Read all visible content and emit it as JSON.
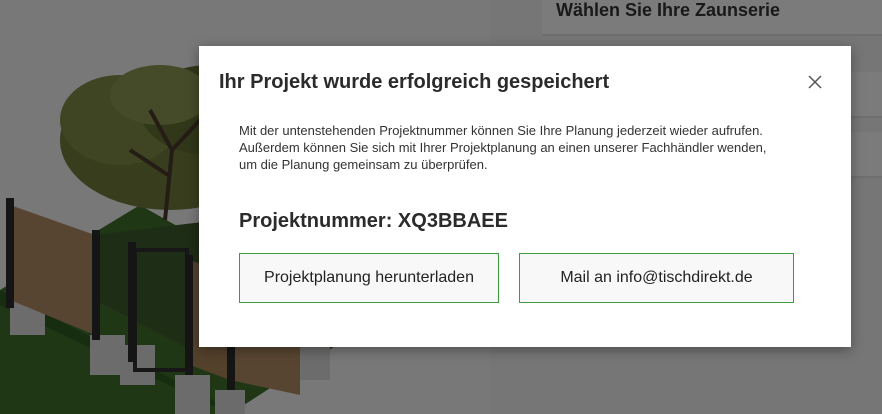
{
  "side_panel": {
    "header": "Wählen Sie Ihre Zaunserie"
  },
  "modal": {
    "title": "Ihr Projekt wurde erfolgreich gespeichert",
    "close_icon": "close-icon",
    "text_lines": [
      "Mit der untenstehenden Projektnummer können Sie Ihre Planung jederzeit wieder aufrufen.",
      "Außerdem können Sie sich mit Ihrer Projektplanung an einen unserer Fachhändler wenden,",
      "um die Planung gemeinsam zu überprüfen."
    ],
    "project_number_label": "Projektnummer: XQ3BBAEE",
    "download_button": "Projektplanung herunterladen",
    "mail_button": "Mail an info@tischdirekt.de"
  },
  "colors": {
    "button_border": "#3d9b3d",
    "overlay": "rgba(0,0,0,0.5)"
  }
}
